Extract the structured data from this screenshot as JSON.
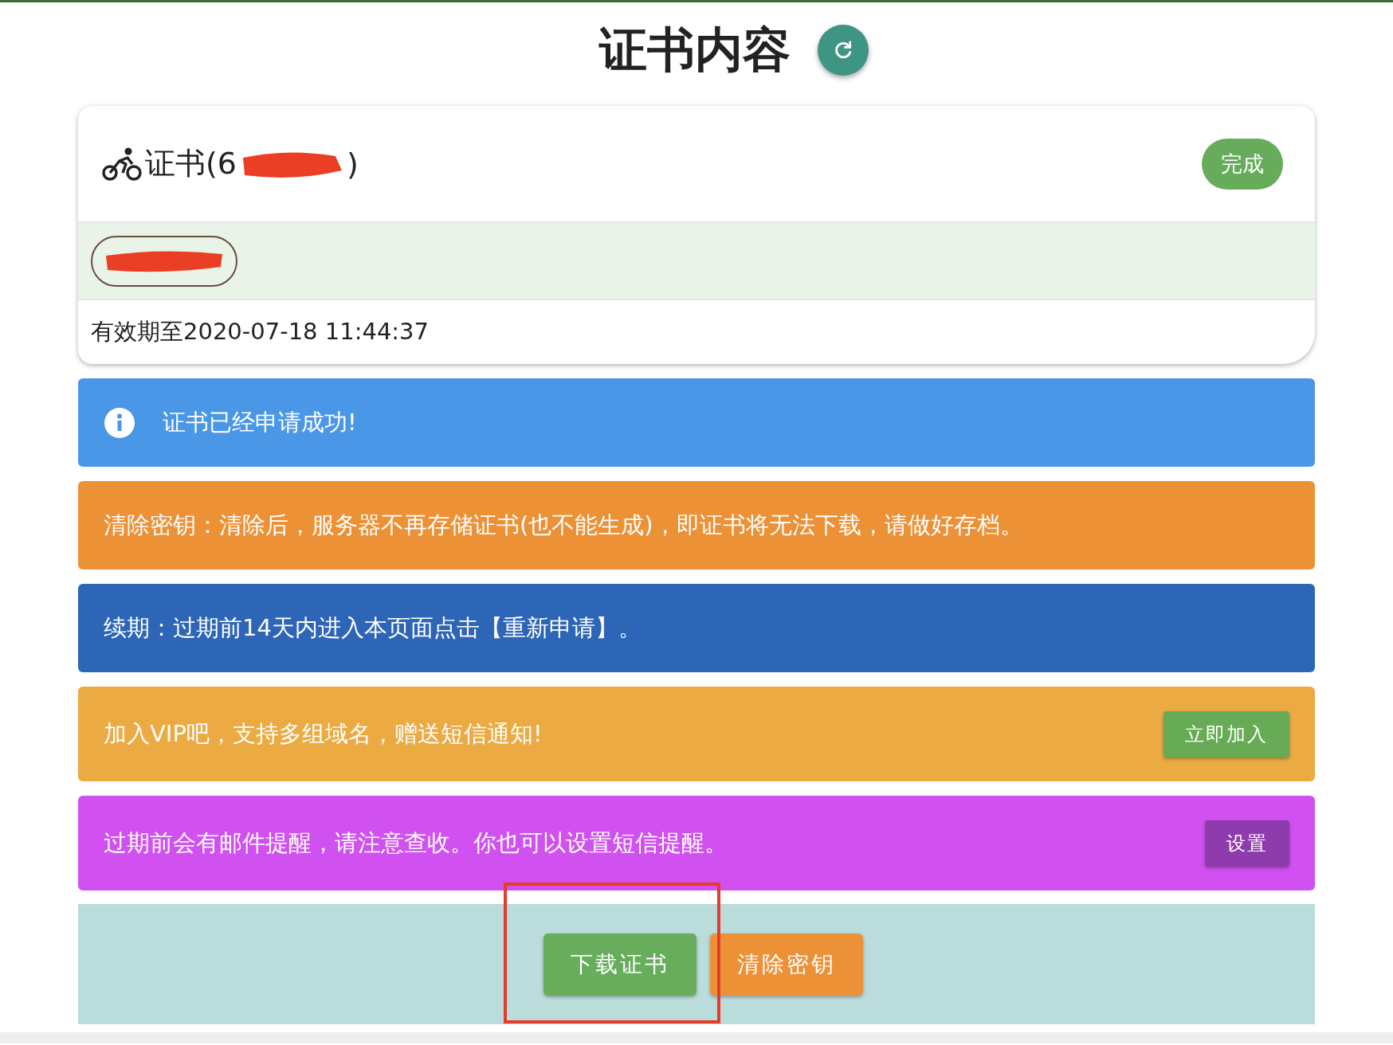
{
  "page_title": "证书内容",
  "card": {
    "title_start": "证书(6",
    "title_end": ")",
    "redacted": true,
    "status": "完成",
    "chip_redacted": true,
    "validity": "有效期至2020-07-18 11:44:37"
  },
  "alerts": [
    {
      "kind": "info",
      "color": "#4a97e8",
      "text": "证书已经申请成功!"
    },
    {
      "kind": "plain",
      "color": "#ec9136",
      "text": "清除密钥：清除后，服务器不再存储证书(也不能生成)，即证书将无法下载，请做好存档。"
    },
    {
      "kind": "plain",
      "color": "#2d65b7",
      "text": "续期：过期前14天内进入本页面点击【重新申请】。"
    },
    {
      "kind": "action",
      "color": "#ecaa42",
      "text": "加入VIP吧，支持多组域名，赠送短信通知!",
      "button": {
        "label": "立即加入",
        "color": "#67ab57"
      }
    },
    {
      "kind": "action",
      "color": "#d151f0",
      "text": "过期前会有邮件提醒，请注意查收。你也可以设置短信提醒。",
      "button": {
        "label": "设置",
        "color": "#8e3bad"
      }
    }
  ],
  "actions": [
    {
      "label": "下载证书",
      "color": "#67ad5b",
      "highlighted": true
    },
    {
      "label": "清除密钥",
      "color": "#ed9136",
      "highlighted": false
    }
  ]
}
